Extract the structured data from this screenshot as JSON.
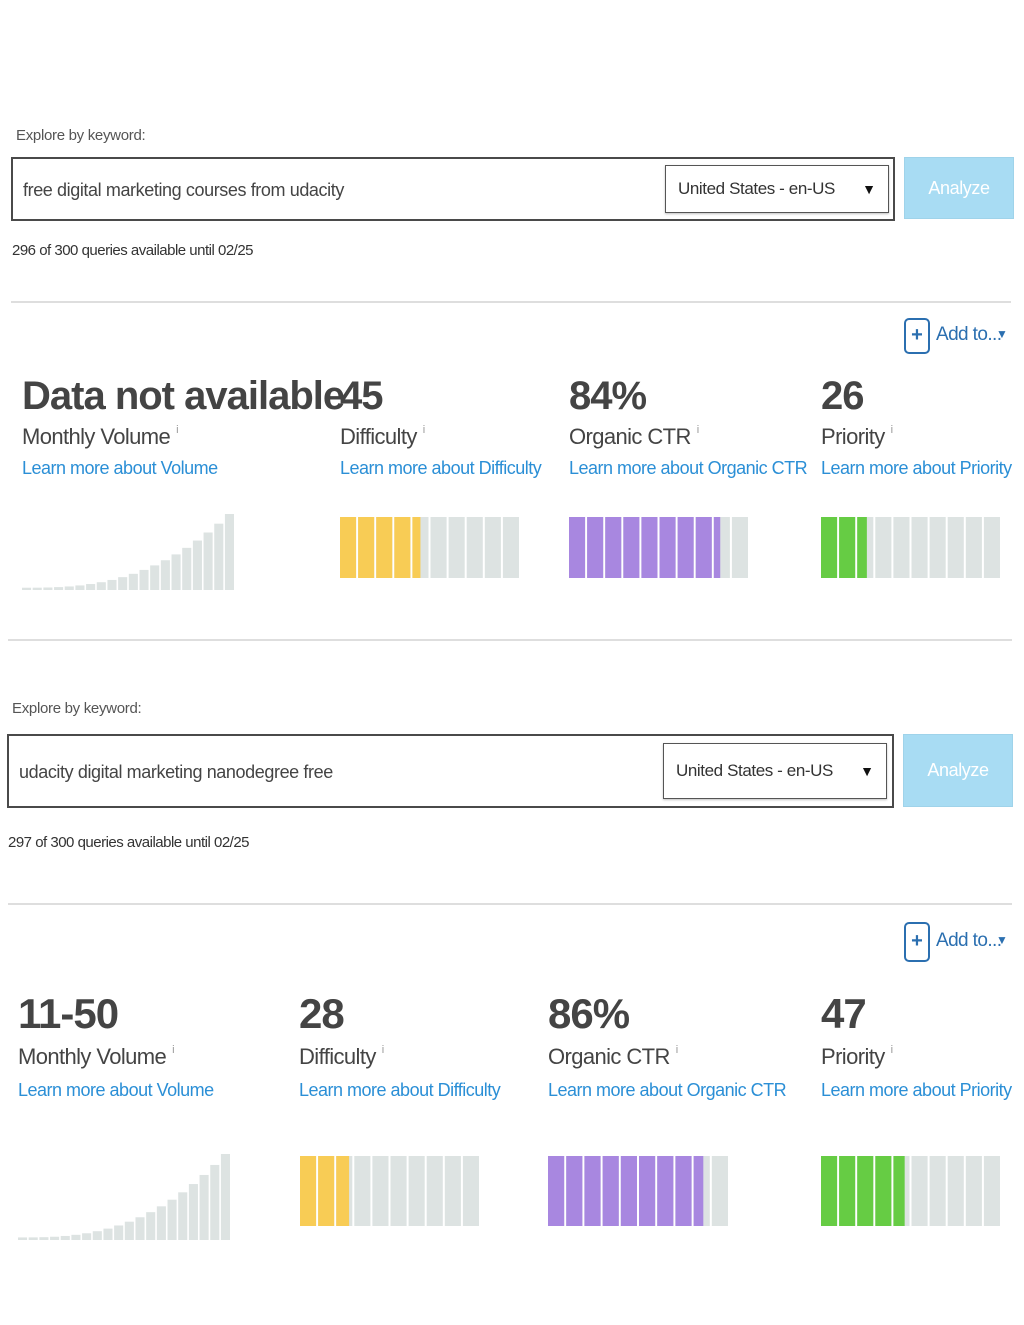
{
  "colors": {
    "difficulty": "#f8cc55",
    "ctr": "#a887e0",
    "priority": "#66cc44",
    "inactive": "#dde3e2",
    "link": "#2b8fd6",
    "analyze_bg": "#a8dcf3"
  },
  "icons": {
    "add": "plus-box-icon",
    "caret": "caret-down-icon",
    "info": "info-icon"
  },
  "searches": [
    {
      "explore_label": "Explore by keyword:",
      "keyword": "free digital marketing courses from udacity",
      "locale": "United States - en-US",
      "analyze_label": "Analyze",
      "quota": "296 of 300 queries available until 02/25",
      "add_to": "Add to...",
      "metrics": {
        "volume": {
          "value": "Data not available",
          "label": "Monthly Volume",
          "link": "Learn more about Volume"
        },
        "difficulty": {
          "value": "45",
          "label": "Difficulty",
          "link": "Learn more about Difficulty",
          "level": 0.45
        },
        "ctr": {
          "value": "84%",
          "label": "Organic CTR",
          "link": "Learn more about Organic CTR",
          "level": 0.84
        },
        "priority": {
          "value": "26",
          "label": "Priority",
          "link": "Learn more about Priority",
          "level": 0.26
        }
      }
    },
    {
      "explore_label": "Explore by keyword:",
      "keyword": "udacity digital marketing nanodegree free",
      "locale": "United States - en-US",
      "analyze_label": "Analyze",
      "quota": "297 of 300 queries available until 02/25",
      "add_to": "Add to...",
      "metrics": {
        "volume": {
          "value": "11-50",
          "label": "Monthly Volume",
          "link": "Learn more about Volume"
        },
        "difficulty": {
          "value": "28",
          "label": "Difficulty",
          "link": "Learn more about Difficulty",
          "level": 0.28
        },
        "ctr": {
          "value": "86%",
          "label": "Organic CTR",
          "link": "Learn more about Organic CTR",
          "level": 0.86
        },
        "priority": {
          "value": "47",
          "label": "Priority",
          "link": "Learn more about Priority",
          "level": 0.47
        }
      }
    }
  ]
}
